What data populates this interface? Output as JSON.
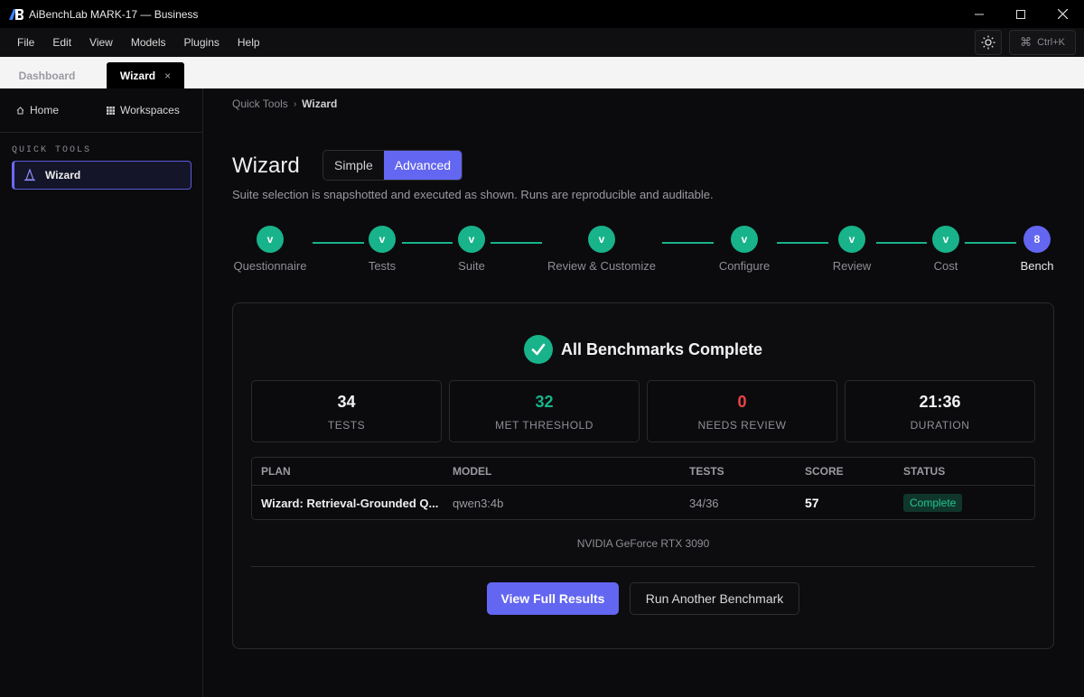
{
  "window": {
    "logo_text": "AB",
    "title": "AiBenchLab MARK-17 — Business"
  },
  "menu": [
    "File",
    "Edit",
    "View",
    "Models",
    "Plugins",
    "Help"
  ],
  "command_shortcut": "Ctrl+K",
  "tabs": [
    {
      "label": "Dashboard",
      "active": false
    },
    {
      "label": "Wizard",
      "active": true,
      "close": "×"
    }
  ],
  "sidebar": {
    "home": "Home",
    "workspaces": "Workspaces",
    "section": "QUICK TOOLS",
    "items": [
      {
        "label": "Wizard",
        "icon": "wizard-hat-icon",
        "active": true
      }
    ]
  },
  "breadcrumb": {
    "parent": "Quick Tools",
    "separator": "›",
    "current": "Wizard"
  },
  "page": {
    "title": "Wizard",
    "mode_toggle": {
      "options": [
        "Simple",
        "Advanced"
      ],
      "selected": "Advanced"
    },
    "subtitle": "Suite selection is snapshotted and executed as shown. Runs are reproducible and auditable."
  },
  "steps": [
    {
      "label": "Questionnaire",
      "marker": "v",
      "state": "done"
    },
    {
      "label": "Tests",
      "marker": "v",
      "state": "done"
    },
    {
      "label": "Suite",
      "marker": "v",
      "state": "done"
    },
    {
      "label": "Review & Customize",
      "marker": "v",
      "state": "done"
    },
    {
      "label": "Configure",
      "marker": "v",
      "state": "done"
    },
    {
      "label": "Review",
      "marker": "v",
      "state": "done"
    },
    {
      "label": "Cost",
      "marker": "v",
      "state": "done"
    },
    {
      "label": "Bench",
      "marker": "8",
      "state": "current"
    }
  ],
  "result": {
    "title": "All Benchmarks Complete",
    "stats": [
      {
        "value": "34",
        "label": "TESTS",
        "color": "#f2f2f4"
      },
      {
        "value": "32",
        "label": "MET THRESHOLD",
        "color": "#18b38a"
      },
      {
        "value": "0",
        "label": "NEEDS REVIEW",
        "color": "#ef4444"
      },
      {
        "value": "21:36",
        "label": "DURATION",
        "color": "#f2f2f4"
      }
    ],
    "table": {
      "headers": [
        "PLAN",
        "MODEL",
        "TESTS",
        "SCORE",
        "STATUS"
      ],
      "rows": [
        {
          "plan": "Wizard: Retrieval-Grounded Q...",
          "model": "qwen3:4b",
          "tests": "34/36",
          "score": "57",
          "status": "Complete"
        }
      ]
    },
    "gpu": "NVIDIA GeForce RTX 3090",
    "primary_button": "View Full Results",
    "secondary_button": "Run Another Benchmark"
  },
  "colors": {
    "accent": "#6366f1",
    "success": "#18b38a",
    "danger": "#ef4444"
  }
}
